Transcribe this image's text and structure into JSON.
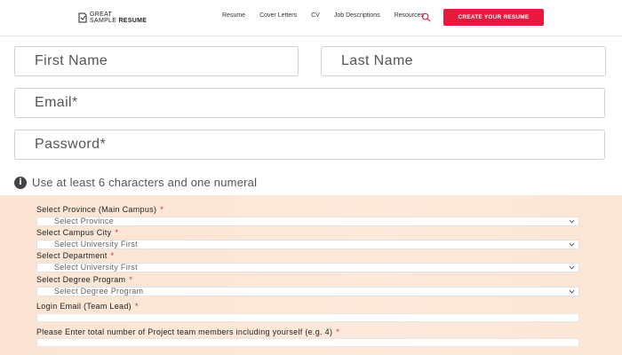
{
  "header": {
    "logo_line1": "GREAT",
    "logo_line2a": "SAMPLE ",
    "logo_line2b": "RESUME",
    "nav": [
      "Resume",
      "Cover Letters",
      "CV",
      "Job Descriptions",
      "Resources"
    ],
    "cta_label": "CREATE YOUR RESUME",
    "accent_color": "#e8193d"
  },
  "form": {
    "first_name_placeholder": "First Name",
    "last_name_placeholder": "Last Name",
    "email_placeholder": "Email*",
    "password_placeholder": "Password*",
    "password_hint": "Use at least 6 characters and one numeral"
  },
  "project_form": {
    "province_label": "Select Province (Main Campus)",
    "province_value": "Select Province",
    "campus_label": "Select Campus City",
    "campus_value": "Select University First",
    "department_label": "Select Department",
    "department_value": "Select University First",
    "degree_label": "Select Degree Program",
    "degree_value": "Select Degree Program",
    "login_email_label": "Login Email (Team Lead)",
    "members_label": "Please Enter total number of Project team members including yourself (e.g. 4)",
    "required_mark": "*"
  }
}
